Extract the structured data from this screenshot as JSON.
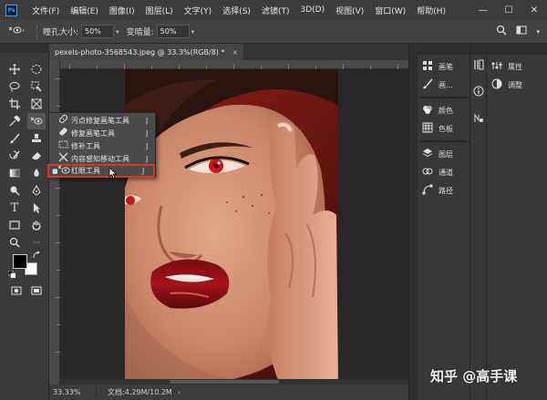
{
  "app": {
    "logo": "Ps"
  },
  "menu": [
    "文件(F)",
    "编辑(E)",
    "图像(I)",
    "图层(L)",
    "文字(Y)",
    "选择(S)",
    "滤镜(T)",
    "3D(D)",
    "视图(V)",
    "窗口(W)",
    "帮助(H)"
  ],
  "window_controls": {
    "minimize": "—",
    "maximize": "☐",
    "close": "✕"
  },
  "options": {
    "pupil_label": "瞳孔大小:",
    "pupil_value": "50%",
    "darken_label": "变暗量:",
    "darken_value": "50%"
  },
  "document": {
    "tab_title": "pexels-photo-3568543.jpeg @ 33.3%(RGB/8) *",
    "tab_close": "×"
  },
  "status": {
    "zoom": "33.33%",
    "doc_info": "文档:4.29M/10.2M",
    "arrow": "›"
  },
  "flyout": {
    "items": [
      {
        "label": "污点修复画笔工具",
        "key": "J",
        "icon": "spot-healing-icon",
        "selected": false
      },
      {
        "label": "修复画笔工具",
        "key": "J",
        "icon": "healing-brush-icon",
        "selected": false
      },
      {
        "label": "修补工具",
        "key": "J",
        "icon": "patch-icon",
        "selected": false
      },
      {
        "label": "内容感知移动工具",
        "key": "J",
        "icon": "content-aware-move-icon",
        "selected": false
      },
      {
        "label": "红眼工具",
        "key": "J",
        "icon": "red-eye-icon",
        "selected": true
      }
    ]
  },
  "panels": {
    "col1": [
      {
        "label": "画笔",
        "icon": "brush-panel-icon"
      },
      {
        "label": "画...",
        "icon": "brush-settings-icon"
      },
      {
        "label": "颜色",
        "icon": "color-panel-icon"
      },
      {
        "label": "色板",
        "icon": "swatches-panel-icon"
      },
      {
        "label": "图层",
        "icon": "layers-panel-icon"
      },
      {
        "label": "通道",
        "icon": "channels-panel-icon"
      },
      {
        "label": "路径",
        "icon": "paths-panel-icon"
      }
    ],
    "col2": [
      {
        "label": "属性",
        "icon": "properties-panel-icon"
      },
      {
        "label": "调整",
        "icon": "adjustments-panel-icon"
      }
    ]
  },
  "watermark": "知乎 @高手课",
  "colors": {
    "accent_red": "#d9342b",
    "foreground": "#000000",
    "background": "#ffffff"
  }
}
